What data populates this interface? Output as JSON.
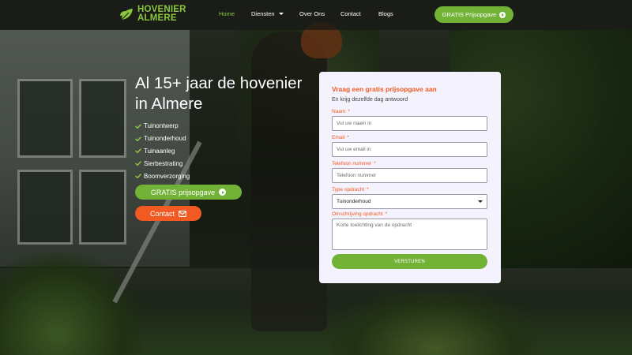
{
  "brand": {
    "line1": "HOVENIER",
    "line2": "ALMERE",
    "color": "#8cc63f"
  },
  "nav": {
    "items": [
      {
        "label": "Home",
        "active": true
      },
      {
        "label": "Diensten",
        "dropdown": true
      },
      {
        "label": "Over Ons"
      },
      {
        "label": "Contact"
      },
      {
        "label": "Blogs"
      }
    ],
    "cta_label": "GRATIS Prijsopgave"
  },
  "hero": {
    "title": "Al 15+ jaar de hovenier in Almere",
    "services": [
      "Tuinontwerp",
      "Tuinonderhoud",
      "Tuinaanleg",
      "Sierbestrating",
      "Boomverzorging"
    ],
    "quote_button": "GRATIS prijsopgave",
    "contact_button": "Contact"
  },
  "form": {
    "title": "Vraag een gratis prijsopgave aan",
    "subtitle": "En krijg dezelfde dag antwoord",
    "fields": {
      "naam": {
        "label": "Naam",
        "placeholder": "Vul uw naam in"
      },
      "email": {
        "label": "Email",
        "placeholder": "Vul uw email in"
      },
      "telefoon": {
        "label": "Telefoon nummer",
        "placeholder": "Telefoon nummer"
      },
      "type": {
        "label": "Type opdracht",
        "value": "Tuinonderhoud"
      },
      "omschrijving": {
        "label": "Omschrijving opdracht",
        "placeholder": "Korte toelichting van de opdracht"
      }
    },
    "submit_label": "VERSTUREN"
  },
  "colors": {
    "green": "#72b236",
    "orange": "#f15a22",
    "card_bg": "#f4f2fc"
  },
  "icons": [
    "leaf-logo-icon",
    "chevron-down-icon",
    "arrow-circle-icon",
    "check-icon",
    "envelope-icon"
  ]
}
